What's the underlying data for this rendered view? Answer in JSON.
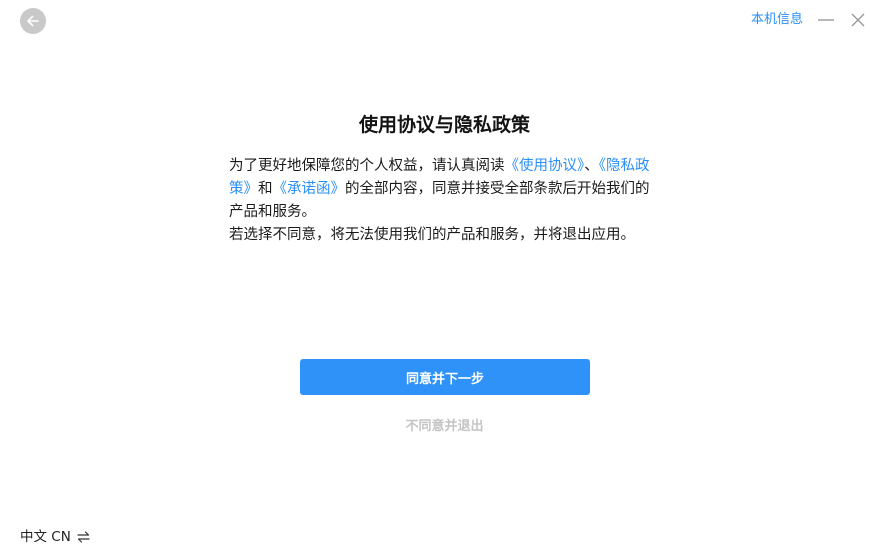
{
  "header": {
    "device_info_label": "本机信息"
  },
  "icons": {
    "back": "arrow-left-icon",
    "minimize": "minimize-icon",
    "close": "close-icon",
    "swap": "swap-arrows-icon"
  },
  "content": {
    "title": "使用协议与隐私政策",
    "paragraph1": {
      "text_before": "为了更好地保障您的个人权益，请认真阅读",
      "link_usage": "《使用协议》",
      "sep1": "、",
      "link_privacy": "《隐私政策》",
      "sep2": "和",
      "link_commitment": "《承诺函》",
      "text_after": "的全部内容，同意并接受全部条款后开始我们的产品和服务。"
    },
    "paragraph2": "若选择不同意，将无法使用我们的产品和服务，并将退出应用。"
  },
  "actions": {
    "agree_label": "同意并下一步",
    "disagree_label": "不同意并退出"
  },
  "footer": {
    "language_label": "中文 CN"
  },
  "colors": {
    "accent": "#2e92f9",
    "link": "#2b8ff7",
    "disabled_text": "#c4c4c4",
    "back_button_bg": "#c9c9c9"
  }
}
